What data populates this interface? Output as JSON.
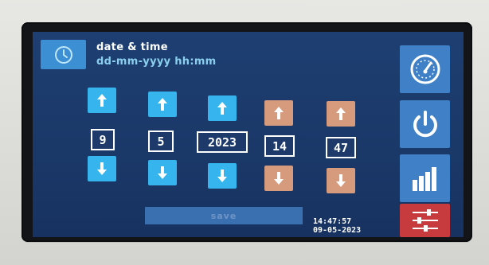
{
  "header": {
    "title": "date & time",
    "subtitle": "dd-mm-yyyy hh:mm",
    "icon": "clock-icon"
  },
  "fields": [
    {
      "name": "day",
      "value": "9",
      "accent": "blue"
    },
    {
      "name": "month",
      "value": "5",
      "accent": "blue"
    },
    {
      "name": "year",
      "value": "2023",
      "accent": "blue"
    },
    {
      "name": "hour",
      "value": "14",
      "accent": "orange"
    },
    {
      "name": "minute",
      "value": "47",
      "accent": "orange"
    }
  ],
  "save_label": "save",
  "status": {
    "time": "14:47:57",
    "date": "09-05-2023"
  },
  "rail": [
    {
      "icon": "gauge-icon"
    },
    {
      "icon": "power-icon"
    },
    {
      "icon": "bar-chart-icon"
    },
    {
      "icon": "sliders-icon",
      "active": true
    }
  ],
  "colors": {
    "screen_bg": "#1e3f72",
    "blue_button": "#35b4ee",
    "orange_button": "#d69a7c",
    "rail_blue": "#3f80c6",
    "rail_active": "#c73a3e",
    "subtitle": "#8ad0ee"
  }
}
